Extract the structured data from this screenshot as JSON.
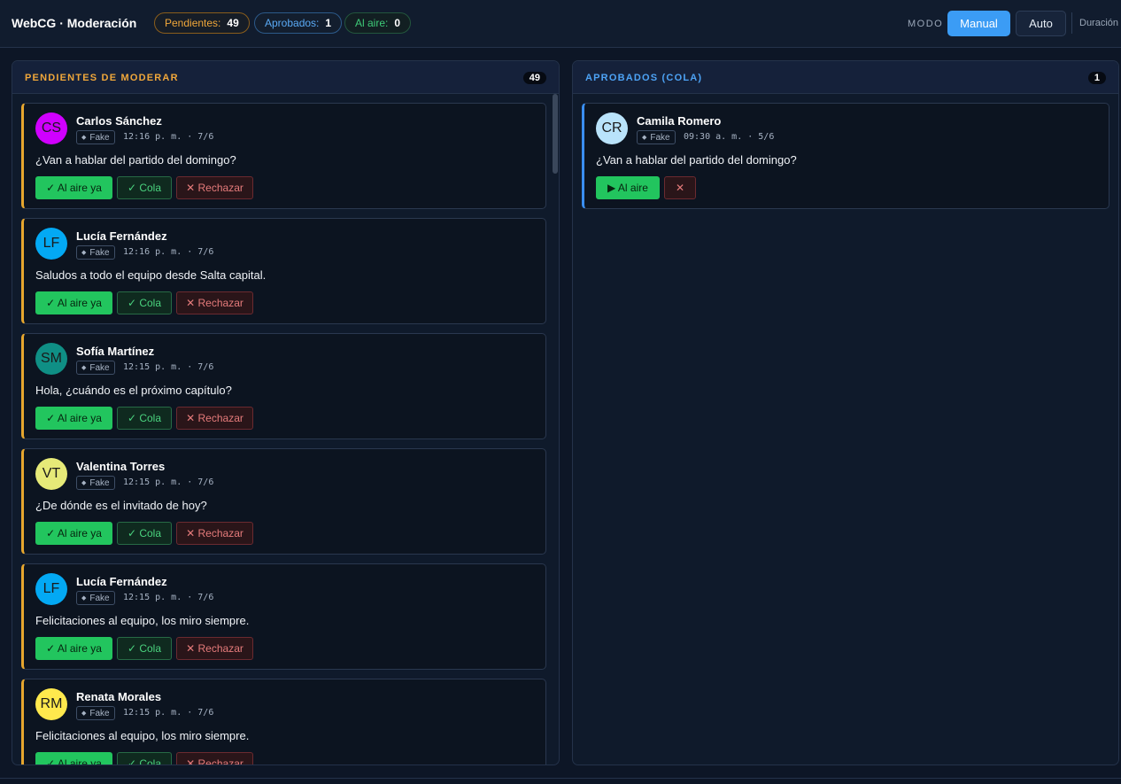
{
  "header": {
    "title": "WebCG · Moderación",
    "stats": {
      "pending_label": "Pendientes:",
      "pending_count": "49",
      "approved_label": "Aprobados:",
      "approved_count": "1",
      "onair_label": "Al aire:",
      "onair_count": "0"
    },
    "mode_label": "MODO",
    "mode_manual": "Manual",
    "mode_auto": "Auto",
    "duration_label": "Duración"
  },
  "pending": {
    "title": "PENDIENTES DE MODERAR",
    "count": "49",
    "cards": [
      {
        "initials": "CS",
        "avatar_color": "#d000ff",
        "author": "Carlos Sánchez",
        "source": "Fake",
        "time": "12:16 p. m. · 7/6",
        "message": "¿Van a hablar del partido del domingo?"
      },
      {
        "initials": "LF",
        "avatar_color": "#03a9f4",
        "author": "Lucía Fernández",
        "source": "Fake",
        "time": "12:16 p. m. · 7/6",
        "message": "Saludos a todo el equipo desde Salta capital."
      },
      {
        "initials": "SM",
        "avatar_color": "#0f8f85",
        "author": "Sofía Martínez",
        "source": "Fake",
        "time": "12:15 p. m. · 7/6",
        "message": "Hola, ¿cuándo es el próximo capítulo?"
      },
      {
        "initials": "VT",
        "avatar_color": "#e6ea78",
        "author": "Valentina Torres",
        "source": "Fake",
        "time": "12:15 p. m. · 7/6",
        "message": "¿De dónde es el invitado de hoy?"
      },
      {
        "initials": "LF",
        "avatar_color": "#03a9f4",
        "author": "Lucía Fernández",
        "source": "Fake",
        "time": "12:15 p. m. · 7/6",
        "message": "Felicitaciones al equipo, los miro siempre."
      },
      {
        "initials": "RM",
        "avatar_color": "#ffe94d",
        "author": "Renata Morales",
        "source": "Fake",
        "time": "12:15 p. m. · 7/6",
        "message": "Felicitaciones al equipo, los miro siempre."
      }
    ],
    "btn_air": "✓ Al aire ya",
    "btn_queue": "✓ Cola",
    "btn_reject": "✕ Rechazar"
  },
  "approved": {
    "title": "APROBADOS (COLA)",
    "count": "1",
    "cards": [
      {
        "initials": "CR",
        "avatar_color": "#b9e3fb",
        "author": "Camila Romero",
        "source": "Fake",
        "time": "09:30 a. m. · 5/6",
        "message": "¿Van a hablar del partido del domingo?"
      }
    ],
    "btn_air": "▶ Al aire",
    "btn_remove": "✕"
  },
  "colors": {
    "background": "#0d1626",
    "pending_accent": "#f0a73a",
    "approved_accent": "#4da3f5",
    "onair_accent": "#3ecb78",
    "primary_button": "#3b9cf5",
    "success_button": "#22c55e"
  }
}
